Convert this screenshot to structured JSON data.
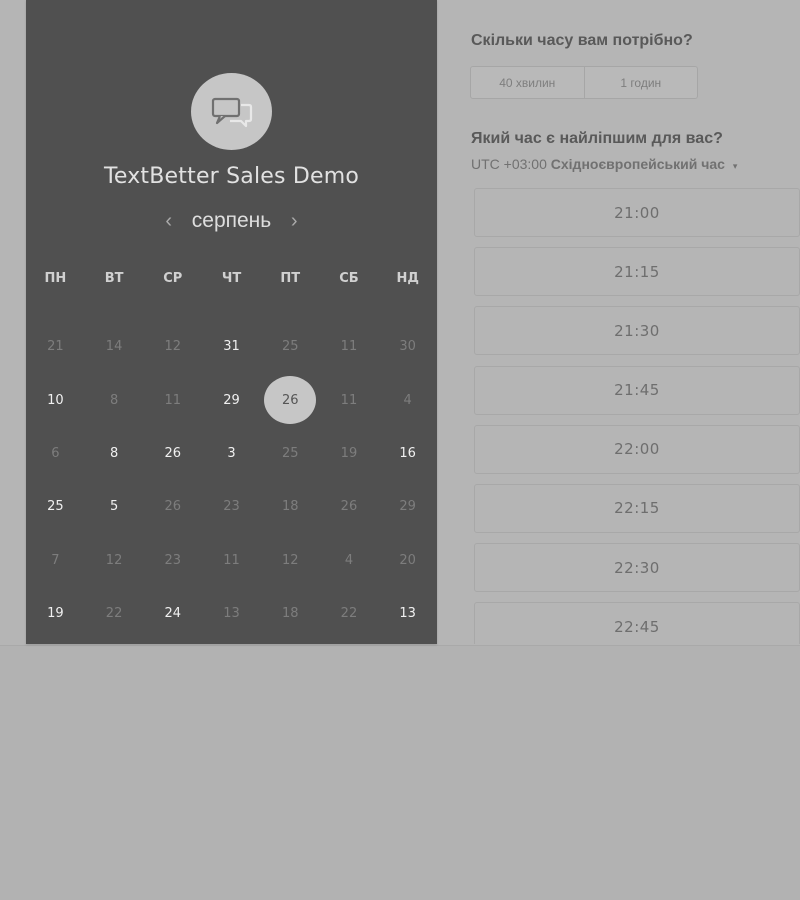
{
  "booking": {
    "title": "TextBetter Sales Demo",
    "logo_icon": "chat-bubbles-icon",
    "month": "серпень",
    "prev_icon": "chevron-left-icon",
    "next_icon": "chevron-right-icon",
    "weekdays": [
      "ПН",
      "ВТ",
      "СР",
      "ЧТ",
      "ПТ",
      "СБ",
      "НД"
    ],
    "weeks": [
      [
        {
          "d": "21"
        },
        {
          "d": "14"
        },
        {
          "d": "12"
        },
        {
          "d": "31",
          "a": true
        },
        {
          "d": "25"
        },
        {
          "d": "11"
        },
        {
          "d": "30"
        }
      ],
      [
        {
          "d": "10",
          "a": true
        },
        {
          "d": "8"
        },
        {
          "d": "11"
        },
        {
          "d": "29",
          "a": true
        },
        {
          "d": "26",
          "s": true
        },
        {
          "d": "11"
        },
        {
          "d": "4"
        }
      ],
      [
        {
          "d": "6"
        },
        {
          "d": "8",
          "a": true
        },
        {
          "d": "26",
          "a": true
        },
        {
          "d": "3",
          "a": true
        },
        {
          "d": "25"
        },
        {
          "d": "19"
        },
        {
          "d": "16",
          "a": true
        }
      ],
      [
        {
          "d": "25",
          "a": true
        },
        {
          "d": "5",
          "a": true
        },
        {
          "d": "26"
        },
        {
          "d": "23"
        },
        {
          "d": "18"
        },
        {
          "d": "26"
        },
        {
          "d": "29"
        }
      ],
      [
        {
          "d": "7"
        },
        {
          "d": "12"
        },
        {
          "d": "23"
        },
        {
          "d": "11"
        },
        {
          "d": "12"
        },
        {
          "d": "4"
        },
        {
          "d": "20"
        }
      ],
      [
        {
          "d": "19",
          "a": true
        },
        {
          "d": "22"
        },
        {
          "d": "24",
          "a": true
        },
        {
          "d": "13"
        },
        {
          "d": "18"
        },
        {
          "d": "22"
        },
        {
          "d": "13",
          "a": true
        }
      ]
    ]
  },
  "schedule": {
    "duration_question": "Скільки часу вам потрібно?",
    "duration_options": [
      "40 хвилин",
      "1 годин"
    ],
    "time_question": "Який час є найліпшим для вас?",
    "tz_offset": "UTC +03:00",
    "tz_name": "Східноєвропейський час",
    "tz_caret": "▾",
    "slots": [
      "21:00",
      "21:15",
      "21:30",
      "21:45",
      "22:00",
      "22:15",
      "22:30",
      "22:45"
    ]
  },
  "colors": {
    "panel_dark": "#505050",
    "overlay_gray": "#b5b5b5",
    "selected_day": "#c6c6c6"
  }
}
